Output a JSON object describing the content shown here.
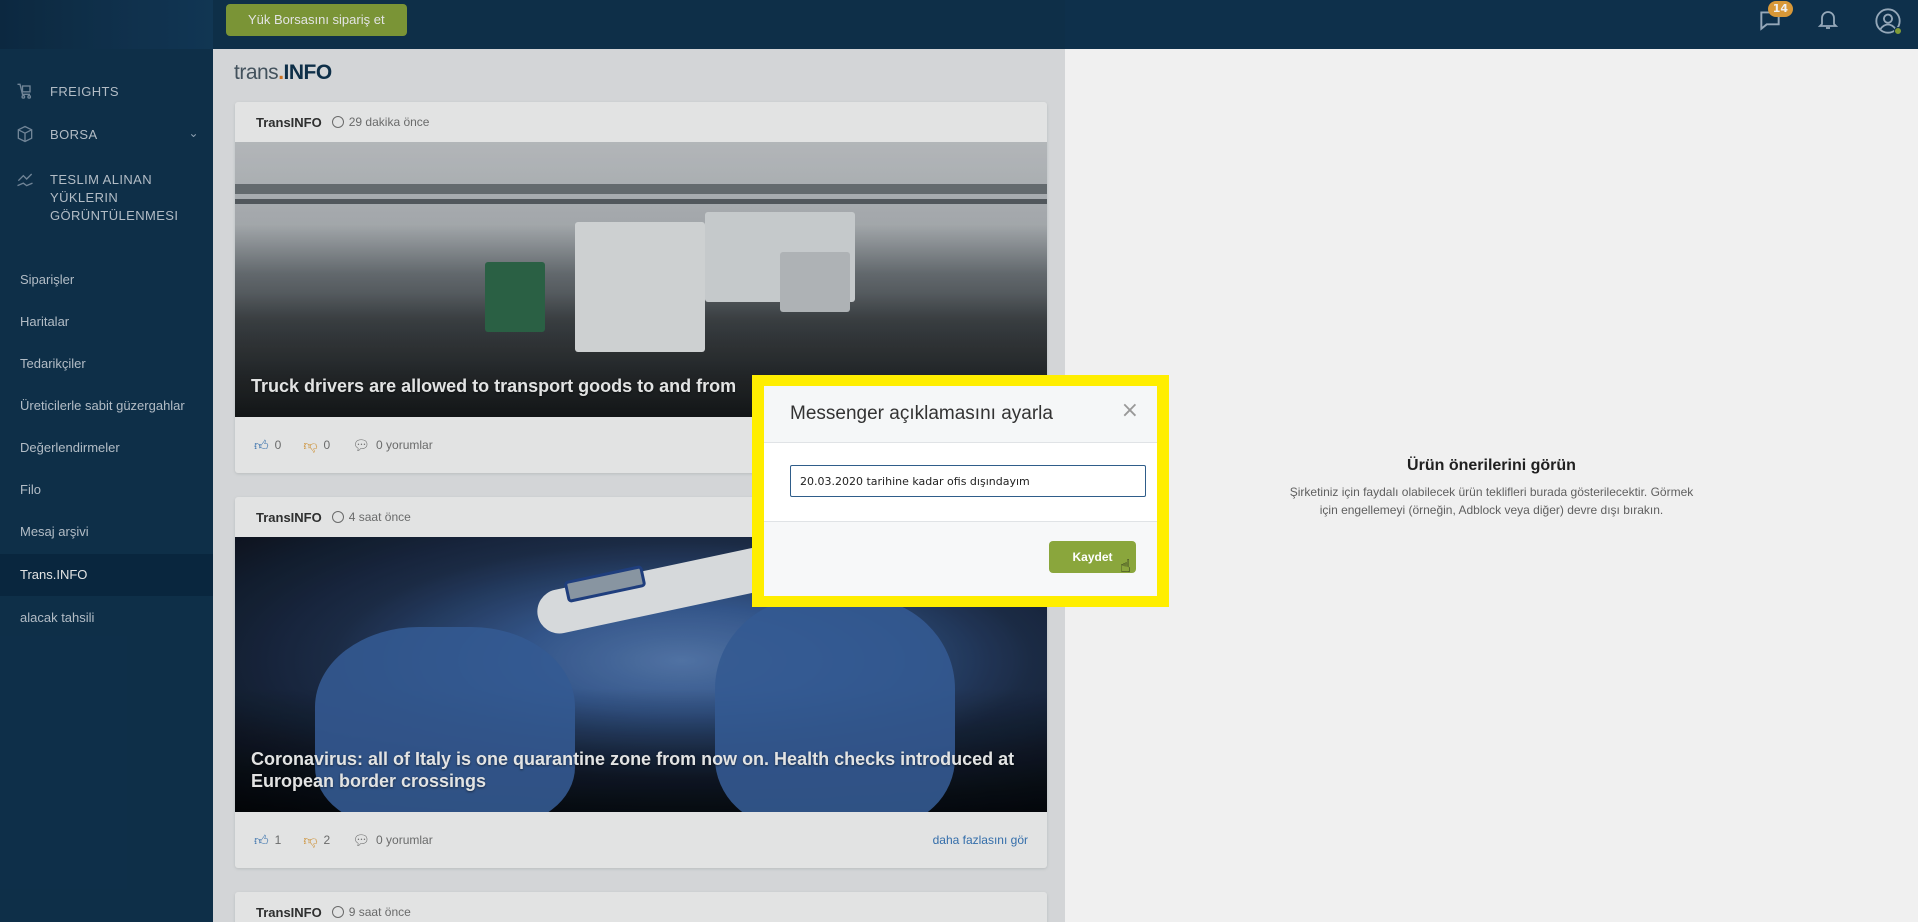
{
  "topbar": {
    "order_button": "Yük Borsasını sipariş et",
    "messages_badge": "14",
    "icons": [
      "chat-icon",
      "bell-icon",
      "user-icon"
    ]
  },
  "sidebar": {
    "main_items": [
      {
        "label": "FREIGHTS",
        "icon": "freights-icon"
      },
      {
        "label": "BORSA",
        "icon": "box-icon"
      },
      {
        "label": "TESLIM ALINAN YÜKLERIN GÖRÜNTÜLENMESI",
        "icon": "delivery-icon"
      }
    ],
    "links": [
      "Siparişler",
      "Haritalar",
      "Tedarikçiler",
      "Üreticilerle sabit güzergahlar",
      "Değerlendirmeler",
      "Filo",
      "Mesaj arşivi",
      "Trans.INFO",
      "alacak tahsili"
    ],
    "active_link": "Trans.INFO"
  },
  "brand": {
    "text_1": "trans",
    "dot": ".",
    "text_2": "INFO"
  },
  "news": [
    {
      "author": "TransINFO",
      "time": "29 dakika önce",
      "title": "Truck drivers are allowed to transport goods to and from",
      "likes": "0",
      "dislikes": "0",
      "comments": "0 yorumlar"
    },
    {
      "author": "TransINFO",
      "time": "4 saat önce",
      "title": "Coronavirus: all of Italy is one quarantine zone from now on. Health checks introduced at European border crossings",
      "likes": "1",
      "dislikes": "2",
      "comments": "0 yorumlar",
      "more": "daha fazlasını gör"
    },
    {
      "author": "TransINFO",
      "time": "9 saat önce"
    }
  ],
  "promo": {
    "title": "Ürün önerilerini görün",
    "text": "Şirketiniz için faydalı olabilecek ürün teklifleri burada gösterilecektir. Görmek için engellemeyi (örneğin, Adblock veya diğer) devre dışı bırakın."
  },
  "modal": {
    "title": "Messenger açıklamasını ayarla",
    "close": "×",
    "input_value": "20.03.2020 tarihine kadar ofis dışındayım",
    "save_label": "Kaydet"
  },
  "colors": {
    "accent": "#8aa63c",
    "nav": "#0f3350",
    "highlight": "#ffee00"
  }
}
